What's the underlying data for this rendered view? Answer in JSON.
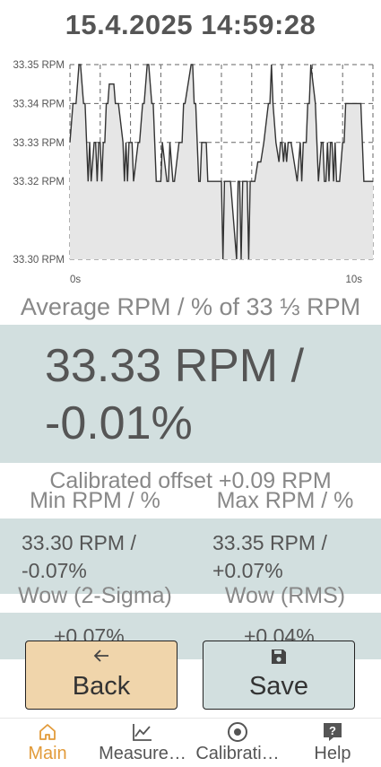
{
  "header": {
    "datetime": "15.4.2025 14:59:28"
  },
  "chart_data": {
    "type": "area",
    "xlabel": "",
    "ylabel": "",
    "x_tick_labels": [
      "0s",
      "10s"
    ],
    "xlim": [
      0,
      10
    ],
    "y_ticks": [
      33.3,
      33.32,
      33.33,
      33.34,
      33.35
    ],
    "y_tick_labels": [
      "33.30 RPM",
      "33.32 RPM",
      "33.33 RPM",
      "33.34 RPM",
      "33.35 RPM"
    ],
    "ylim": [
      33.3,
      33.35
    ],
    "grid": true,
    "fill_color": "#e6e6e6",
    "line_color": "#333333",
    "x": [
      0.0,
      0.1,
      0.2,
      0.3,
      0.35,
      0.45,
      0.5,
      0.55,
      0.6,
      0.65,
      0.7,
      0.8,
      0.85,
      0.9,
      0.95,
      1.0,
      1.05,
      1.1,
      1.15,
      1.2,
      1.25,
      1.3,
      1.45,
      1.5,
      1.6,
      1.75,
      1.8,
      1.85,
      1.9,
      1.95,
      2.05,
      2.1,
      2.25,
      2.3,
      2.4,
      2.45,
      2.55,
      2.6,
      2.7,
      2.75,
      2.8,
      2.85,
      3.0,
      3.05,
      3.2,
      3.25,
      3.3,
      3.4,
      3.45,
      3.6,
      3.7,
      3.75,
      3.8,
      4.0,
      4.05,
      4.1,
      4.15,
      4.2,
      4.25,
      4.3,
      4.35,
      4.5,
      4.55,
      4.6,
      4.7,
      4.8,
      4.85,
      4.9,
      5.0,
      5.05,
      5.1,
      5.2,
      5.3,
      5.5,
      5.55,
      5.6,
      5.65,
      5.7,
      5.8,
      5.85,
      5.9,
      5.95,
      6.0,
      6.05,
      6.1,
      6.2,
      6.25,
      6.3,
      6.4,
      6.55,
      6.6,
      6.65,
      6.7,
      6.8,
      6.9,
      6.95,
      7.0,
      7.05,
      7.1,
      7.15,
      7.2,
      7.3,
      7.5,
      7.6,
      7.65,
      7.7,
      7.8,
      7.85,
      7.9,
      7.95,
      8.1,
      8.15,
      8.2,
      8.3,
      8.35,
      8.4,
      8.45,
      8.5,
      8.55,
      8.6,
      8.65,
      8.7,
      8.75,
      8.8,
      8.9,
      9.0,
      9.05,
      9.1,
      9.2,
      9.3,
      9.6,
      9.7,
      9.8,
      9.9,
      10.0
    ],
    "y": [
      33.33,
      33.34,
      33.34,
      33.35,
      33.35,
      33.34,
      33.34,
      33.33,
      33.32,
      33.33,
      33.32,
      33.33,
      33.33,
      33.32,
      33.33,
      33.33,
      33.32,
      33.33,
      33.33,
      33.34,
      33.34,
      33.345,
      33.345,
      33.34,
      33.34,
      33.33,
      33.32,
      33.33,
      33.32,
      33.33,
      33.33,
      33.32,
      33.33,
      33.33,
      33.34,
      33.34,
      33.35,
      33.35,
      33.34,
      33.34,
      33.33,
      33.32,
      33.32,
      33.33,
      33.32,
      33.32,
      33.33,
      33.32,
      33.32,
      33.33,
      33.33,
      33.34,
      33.34,
      33.35,
      33.35,
      33.34,
      33.34,
      33.33,
      33.32,
      33.32,
      33.33,
      33.33,
      33.32,
      33.32,
      33.32,
      33.32,
      33.32,
      33.32,
      33.32,
      33.3,
      33.32,
      33.32,
      33.32,
      33.3,
      33.32,
      33.32,
      33.3,
      33.32,
      33.32,
      33.32,
      33.3,
      33.32,
      33.32,
      33.32,
      33.32,
      33.325,
      33.325,
      33.325,
      33.33,
      33.34,
      33.34,
      33.35,
      33.34,
      33.33,
      33.325,
      33.33,
      33.33,
      33.325,
      33.33,
      33.325,
      33.33,
      33.33,
      33.32,
      33.33,
      33.32,
      33.33,
      33.33,
      33.34,
      33.34,
      33.35,
      33.34,
      33.33,
      33.32,
      33.33,
      33.33,
      33.32,
      33.32,
      33.33,
      33.32,
      33.33,
      33.33,
      33.32,
      33.33,
      33.32,
      33.32,
      33.33,
      33.33,
      33.34,
      33.34,
      33.34,
      33.34,
      33.32,
      33.32,
      33.32,
      33.32
    ]
  },
  "average": {
    "label": "Average RPM / % of 33 ⅓ RPM",
    "value_line1": "33.33 RPM /",
    "value_line2": "-0.01%"
  },
  "calibrated_offset": "Calibrated offset  +0.09 RPM",
  "min": {
    "label": "Min RPM / %",
    "line1": "33.30 RPM /",
    "line2": "-0.07%"
  },
  "max": {
    "label": "Max RPM / %",
    "line1": "33.35 RPM /",
    "line2": "+0.07%"
  },
  "wow_2sigma": {
    "label": "Wow (2-Sigma)",
    "value": "+0.07%"
  },
  "wow_rms": {
    "label": "Wow (RMS)",
    "value": "+0.04%"
  },
  "buttons": {
    "back": {
      "label": "Back",
      "icon": "arrow-left-icon"
    },
    "save": {
      "label": "Save",
      "icon": "floppy-disk-icon"
    }
  },
  "nav": {
    "active_color": "#e29b3a",
    "items": [
      {
        "label": "Main",
        "icon": "home-icon"
      },
      {
        "label": "Measure…",
        "icon": "line-chart-icon"
      },
      {
        "label": "Calibrati…",
        "icon": "target-icon"
      },
      {
        "label": "Help",
        "icon": "help-icon"
      }
    ]
  }
}
